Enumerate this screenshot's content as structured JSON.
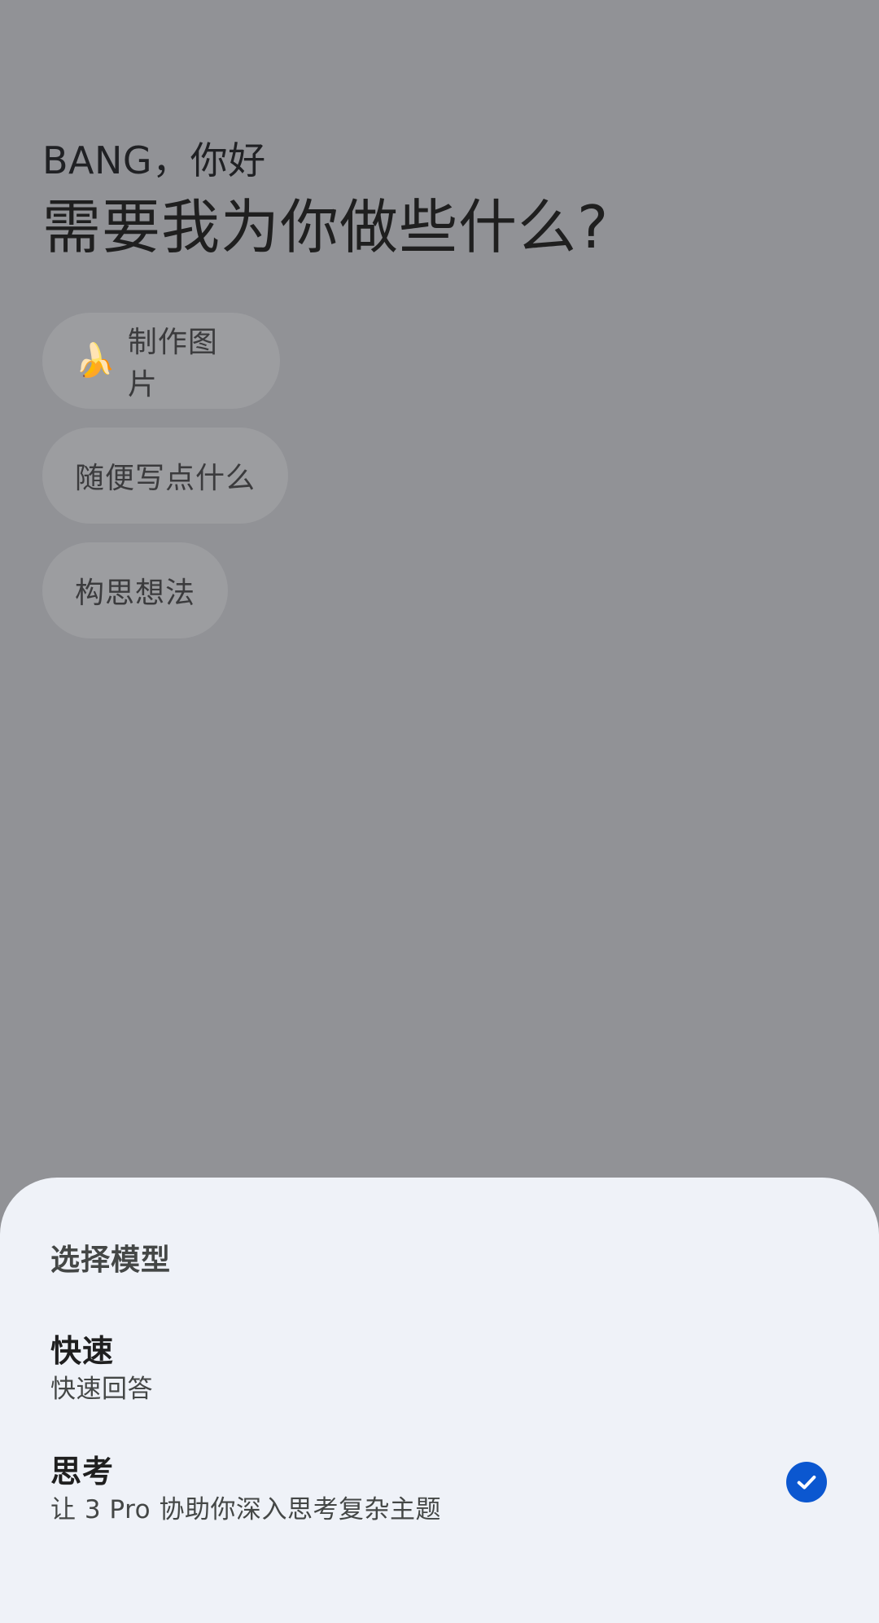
{
  "home": {
    "greeting": "BANG，你好",
    "headline": "需要我为你做些什么?",
    "chips": [
      {
        "label": "制作图片",
        "icon": "banana-icon",
        "emoji": "🍌"
      },
      {
        "label": "随便写点什么"
      },
      {
        "label": "构思想法"
      }
    ]
  },
  "model_sheet": {
    "title": "选择模型",
    "options": [
      {
        "title": "快速",
        "subtitle": "快速回答",
        "selected": false
      },
      {
        "title": "思考",
        "subtitle": "让 3 Pro 协助你深入思考复杂主题",
        "selected": true
      }
    ],
    "selected_icon": "check-circle-icon",
    "accent_color": "#0b57d0"
  }
}
